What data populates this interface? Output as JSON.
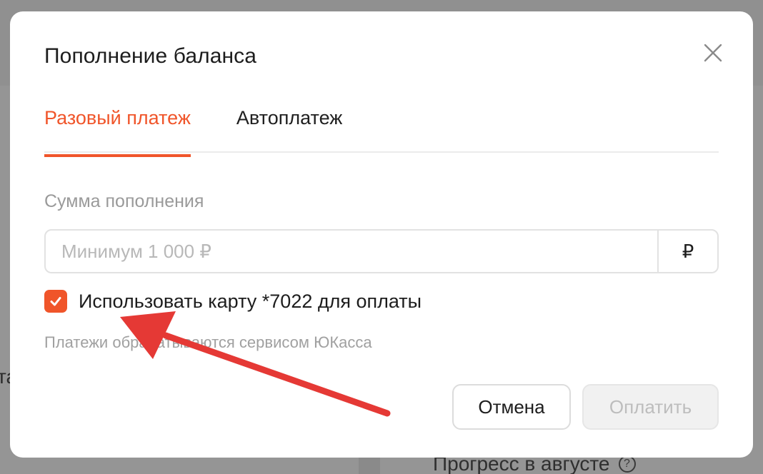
{
  "background": {
    "left_fragment": "та",
    "bottom_text": "Прогресс в августе",
    "help_icon": "question-circle-icon"
  },
  "modal": {
    "title": "Пополнение баланса",
    "close_icon": "close-icon",
    "tabs": [
      {
        "label": "Разовый платеж",
        "active": true
      },
      {
        "label": "Автоплатеж",
        "active": false
      }
    ],
    "amount": {
      "label": "Сумма пополнения",
      "value": "",
      "placeholder": "Минимум 1 000 ₽",
      "currency": "₽"
    },
    "use_card": {
      "checked": true,
      "label": "Использовать карту *7022 для оплаты"
    },
    "hint": "Платежи обрабатываются сервисом ЮКасса",
    "buttons": {
      "cancel": "Отмена",
      "pay": "Оплатить",
      "pay_disabled": true
    }
  },
  "colors": {
    "accent": "#f0552a",
    "annotation_arrow": "#e53935",
    "overlay": "#959595"
  }
}
